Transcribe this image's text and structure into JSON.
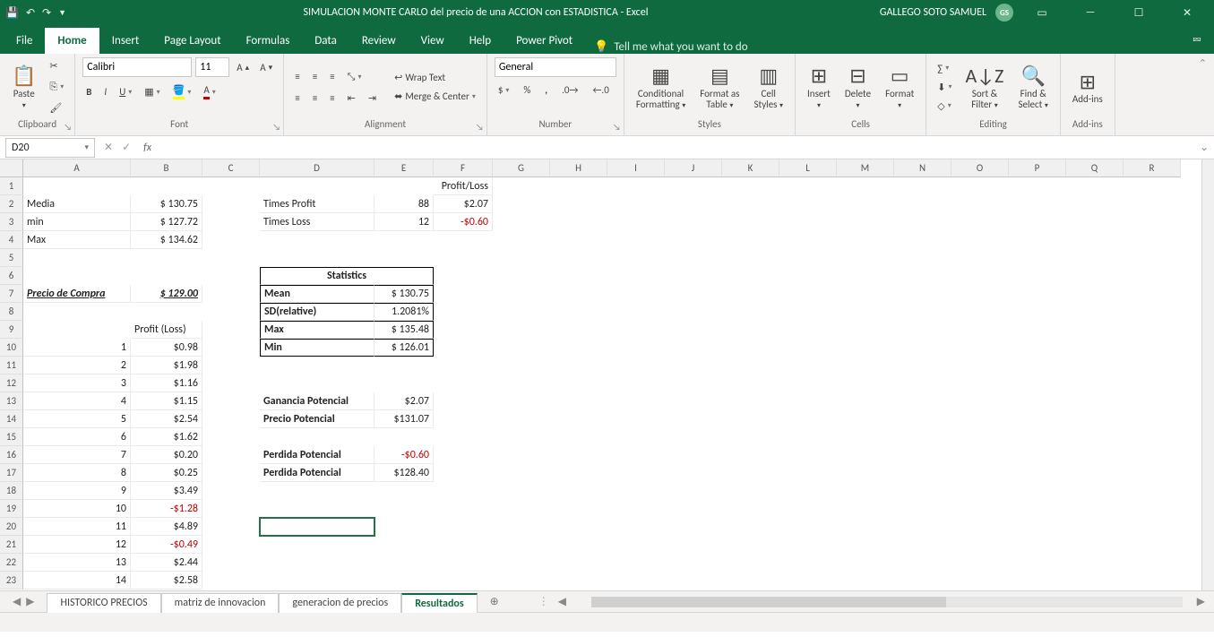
{
  "title": "SIMULACION MONTE CARLO del precio de una ACCION con ESTADISTICA  -  Excel",
  "user": "GALLEGO SOTO SAMUEL",
  "avatar": "GS",
  "tabs": {
    "file": "File",
    "home": "Home",
    "insert": "Insert",
    "pagelayout": "Page Layout",
    "formulas": "Formulas",
    "data": "Data",
    "review": "Review",
    "view": "View",
    "help": "Help",
    "powerpivot": "Power Pivot",
    "tellme": "Tell me what you want to do"
  },
  "ribbon": {
    "clipboard": "Clipboard",
    "paste": "Paste",
    "font": "Font",
    "fontname": "Calibri",
    "fontsize": "11",
    "alignment": "Alignment",
    "wrap": "Wrap Text",
    "merge": "Merge & Center",
    "number": "Number",
    "numfmt": "General",
    "styles": "Styles",
    "condfmt": "Conditional",
    "condfmt2": "Formatting",
    "fmttbl": "Format as",
    "fmttbl2": "Table",
    "cellstyles": "Cell",
    "cellstyles2": "Styles",
    "cells": "Cells",
    "insert": "Insert",
    "delete": "Delete",
    "format": "Format",
    "editing": "Editing",
    "sortfilter": "Sort &",
    "sortfilter2": "Filter",
    "findselect": "Find &",
    "findselect2": "Select",
    "addins": "Add-ins",
    "addinsbtn": "Add-ins"
  },
  "namebox": "D20",
  "columns": [
    {
      "id": "A",
      "w": 120
    },
    {
      "id": "B",
      "w": 80
    },
    {
      "id": "C",
      "w": 64
    },
    {
      "id": "D",
      "w": 128
    },
    {
      "id": "E",
      "w": 66
    },
    {
      "id": "F",
      "w": 66
    },
    {
      "id": "G",
      "w": 64
    },
    {
      "id": "H",
      "w": 64
    },
    {
      "id": "I",
      "w": 64
    },
    {
      "id": "J",
      "w": 64
    },
    {
      "id": "K",
      "w": 64
    },
    {
      "id": "L",
      "w": 64
    },
    {
      "id": "M",
      "w": 64
    },
    {
      "id": "N",
      "w": 64
    },
    {
      "id": "O",
      "w": 64
    },
    {
      "id": "P",
      "w": 64
    },
    {
      "id": "Q",
      "w": 64
    },
    {
      "id": "R",
      "w": 64
    }
  ],
  "rows": 23,
  "cells": [
    {
      "c": "F",
      "r": 1,
      "v": "Profit/Loss",
      "align": "r"
    },
    {
      "c": "A",
      "r": 2,
      "v": "Media"
    },
    {
      "c": "B",
      "r": 2,
      "v": "$    130.75",
      "align": "r"
    },
    {
      "c": "D",
      "r": 2,
      "v": "Times Profit"
    },
    {
      "c": "E",
      "r": 2,
      "v": "88",
      "align": "r"
    },
    {
      "c": "F",
      "r": 2,
      "v": "$2.07",
      "align": "r"
    },
    {
      "c": "A",
      "r": 3,
      "v": "min"
    },
    {
      "c": "B",
      "r": 3,
      "v": "$    127.72",
      "align": "r"
    },
    {
      "c": "D",
      "r": 3,
      "v": "Times Loss"
    },
    {
      "c": "E",
      "r": 3,
      "v": "12",
      "align": "r"
    },
    {
      "c": "F",
      "r": 3,
      "v": "-$0.60",
      "align": "r",
      "cls": "red"
    },
    {
      "c": "A",
      "r": 4,
      "v": "Max"
    },
    {
      "c": "B",
      "r": 4,
      "v": "$    134.62",
      "align": "r"
    },
    {
      "c": "D",
      "r": 6,
      "v": "Statistics",
      "align": "c",
      "cls": "bold blacktop blackleft blackright",
      "span": 2
    },
    {
      "c": "A",
      "r": 7,
      "v": "Precio de Compra",
      "cls": "bold italic und"
    },
    {
      "c": "B",
      "r": 7,
      "v": "$    129.00",
      "align": "r",
      "cls": "bold italic und"
    },
    {
      "c": "D",
      "r": 7,
      "v": "Mean",
      "cls": "bold blacktop blackleft"
    },
    {
      "c": "E",
      "r": 7,
      "v": "$ 130.75",
      "align": "r",
      "cls": "blacktop blackright"
    },
    {
      "c": "D",
      "r": 8,
      "v": "SD(relative)",
      "cls": "bold blacktop blackleft"
    },
    {
      "c": "E",
      "r": 8,
      "v": "1.2081%",
      "align": "r",
      "cls": "blacktop blackright"
    },
    {
      "c": "B",
      "r": 9,
      "v": "Profit (Loss)"
    },
    {
      "c": "D",
      "r": 9,
      "v": "Max",
      "cls": "bold blacktop blackleft"
    },
    {
      "c": "E",
      "r": 9,
      "v": "$ 135.48",
      "align": "r",
      "cls": "blacktop blackright"
    },
    {
      "c": "D",
      "r": 10,
      "v": "Min",
      "cls": "bold blacktop blackbot blackleft"
    },
    {
      "c": "E",
      "r": 10,
      "v": "$ 126.01",
      "align": "r",
      "cls": "blacktop blackbot blackright"
    },
    {
      "c": "A",
      "r": 10,
      "v": "1",
      "align": "r"
    },
    {
      "c": "B",
      "r": 10,
      "v": "$0.98",
      "align": "r"
    },
    {
      "c": "A",
      "r": 11,
      "v": "2",
      "align": "r"
    },
    {
      "c": "B",
      "r": 11,
      "v": "$1.98",
      "align": "r"
    },
    {
      "c": "A",
      "r": 12,
      "v": "3",
      "align": "r"
    },
    {
      "c": "B",
      "r": 12,
      "v": "$1.16",
      "align": "r"
    },
    {
      "c": "A",
      "r": 13,
      "v": "4",
      "align": "r"
    },
    {
      "c": "B",
      "r": 13,
      "v": "$1.15",
      "align": "r"
    },
    {
      "c": "D",
      "r": 13,
      "v": "Ganancia Potencial",
      "cls": "bold"
    },
    {
      "c": "E",
      "r": 13,
      "v": "$2.07",
      "align": "r"
    },
    {
      "c": "A",
      "r": 14,
      "v": "5",
      "align": "r"
    },
    {
      "c": "B",
      "r": 14,
      "v": "$2.54",
      "align": "r"
    },
    {
      "c": "D",
      "r": 14,
      "v": "Precio Potencial",
      "cls": "bold"
    },
    {
      "c": "E",
      "r": 14,
      "v": "$131.07",
      "align": "r"
    },
    {
      "c": "A",
      "r": 15,
      "v": "6",
      "align": "r"
    },
    {
      "c": "B",
      "r": 15,
      "v": "$1.62",
      "align": "r"
    },
    {
      "c": "A",
      "r": 16,
      "v": "7",
      "align": "r"
    },
    {
      "c": "B",
      "r": 16,
      "v": "$0.20",
      "align": "r"
    },
    {
      "c": "D",
      "r": 16,
      "v": "Perdida Potencial",
      "cls": "bold"
    },
    {
      "c": "E",
      "r": 16,
      "v": "-$0.60",
      "align": "r",
      "cls": "red"
    },
    {
      "c": "A",
      "r": 17,
      "v": "8",
      "align": "r"
    },
    {
      "c": "B",
      "r": 17,
      "v": "$0.25",
      "align": "r"
    },
    {
      "c": "D",
      "r": 17,
      "v": "Perdida Potencial",
      "cls": "bold"
    },
    {
      "c": "E",
      "r": 17,
      "v": "$128.40",
      "align": "r"
    },
    {
      "c": "A",
      "r": 18,
      "v": "9",
      "align": "r"
    },
    {
      "c": "B",
      "r": 18,
      "v": "$3.49",
      "align": "r"
    },
    {
      "c": "A",
      "r": 19,
      "v": "10",
      "align": "r"
    },
    {
      "c": "B",
      "r": 19,
      "v": "-$1.28",
      "align": "r",
      "cls": "red"
    },
    {
      "c": "A",
      "r": 20,
      "v": "11",
      "align": "r"
    },
    {
      "c": "B",
      "r": 20,
      "v": "$4.89",
      "align": "r"
    },
    {
      "c": "A",
      "r": 21,
      "v": "12",
      "align": "r"
    },
    {
      "c": "B",
      "r": 21,
      "v": "-$0.49",
      "align": "r",
      "cls": "red"
    },
    {
      "c": "A",
      "r": 22,
      "v": "13",
      "align": "r"
    },
    {
      "c": "B",
      "r": 22,
      "v": "$2.44",
      "align": "r"
    },
    {
      "c": "A",
      "r": 23,
      "v": "14",
      "align": "r"
    },
    {
      "c": "B",
      "r": 23,
      "v": "$2.58",
      "align": "r"
    }
  ],
  "active": {
    "c": "D",
    "r": 20
  },
  "sheets": [
    "HISTORICO PRECIOS",
    "matriz de innovacion",
    "generacion de precios",
    "Resultados"
  ],
  "activesheet": 3
}
